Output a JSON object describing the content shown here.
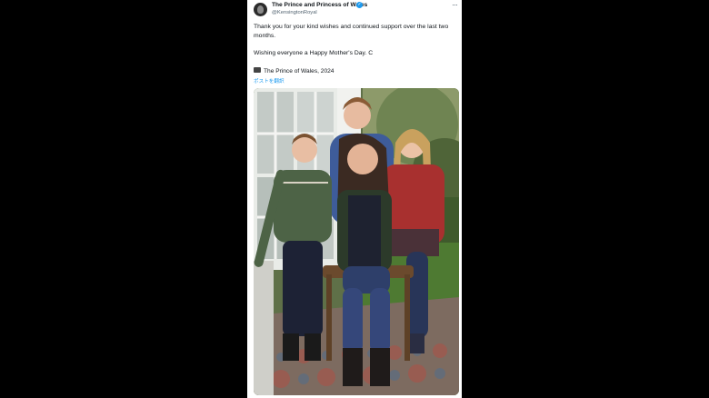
{
  "tweet": {
    "author_name": "The Prince and Princess of Wales",
    "author_handle": "@KensingtonRoyal",
    "more_icon": "···",
    "text_line1": "Thank you for your kind wishes and continued support over the last two months.",
    "text_line2": "Wishing everyone a Happy Mother's Day. C",
    "photo_credit": "The Prince of Wales, 2024",
    "translate_link": "ポストを翻訳"
  },
  "icons": {
    "verified": "verified-badge-icon",
    "more": "more-options-icon",
    "credit": "camera-icon"
  },
  "colors": {
    "background": "#000000",
    "card": "#ffffff",
    "link": "#1d9bf0",
    "text": "#0f1419",
    "secondary": "#536471"
  }
}
